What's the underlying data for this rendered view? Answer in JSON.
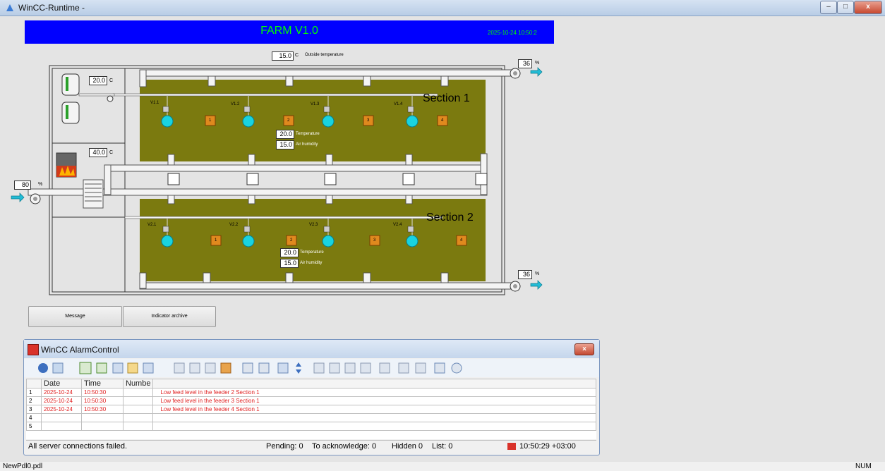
{
  "window": {
    "title": "WinCC-Runtime -",
    "controls": {
      "minimize": "–",
      "maximize": "□",
      "close": "x"
    }
  },
  "header": {
    "title": "FARM V1.0",
    "datetime": "2025-10-24 10:50:2"
  },
  "outside": {
    "value": "15.0",
    "unit": "C",
    "label": "Outside temperature"
  },
  "boiler": {
    "value": "20.0",
    "unit": "C"
  },
  "heater": {
    "value": "40.0",
    "unit": "C"
  },
  "inlet": {
    "value": "80",
    "unit": "%"
  },
  "exhaust_top": {
    "value": "36",
    "unit": "%"
  },
  "exhaust_bottom": {
    "value": "36",
    "unit": "%"
  },
  "section1": {
    "name": "Section 1",
    "valves": [
      "V1.1",
      "V1.2",
      "V1.3",
      "V1.4"
    ],
    "feeders": [
      "1",
      "2",
      "3",
      "4"
    ],
    "temperature": {
      "value": "20.0",
      "label": "Temperature"
    },
    "humidity": {
      "value": "15.0",
      "label": "Air humidity"
    }
  },
  "section2": {
    "name": "Section 2",
    "valves": [
      "V2.1",
      "V2.2",
      "V2.3",
      "V2.4"
    ],
    "feeders": [
      "1",
      "2",
      "3",
      "4"
    ],
    "temperature": {
      "value": "20.0",
      "label": "Temperature"
    },
    "humidity": {
      "value": "15.0",
      "label": "Air humidity"
    }
  },
  "buttons": {
    "message": "Message",
    "indicator_archive": "Indicator archive"
  },
  "alarm": {
    "title": "WinCC AlarmControl",
    "columns": [
      "",
      "Date",
      "Time",
      "Numbe",
      ""
    ],
    "rows": [
      {
        "n": "1",
        "date": "2025-10-24",
        "time": "10:50:30",
        "number": "",
        "text": "Low feed level in the feeder 2 Section 1"
      },
      {
        "n": "2",
        "date": "2025-10-24",
        "time": "10:50:30",
        "number": "",
        "text": "Low feed level in the feeder 3 Section 1"
      },
      {
        "n": "3",
        "date": "2025-10-24",
        "time": "10:50:30",
        "number": "",
        "text": "Low feed level in the feeder 4 Section 1"
      },
      {
        "n": "4",
        "date": "",
        "time": "",
        "number": "",
        "text": ""
      },
      {
        "n": "5",
        "date": "",
        "time": "",
        "number": "",
        "text": ""
      }
    ],
    "status": {
      "message": "All server connections failed.",
      "pending": "Pending: 0",
      "to_ack": "To acknowledge: 0",
      "hidden": "Hidden 0",
      "list": "List: 0",
      "time": "10:50:29 +03:00"
    }
  },
  "statusbar": {
    "file": "NewPdl0.pdl",
    "num": "NUM"
  },
  "colors": {
    "section_fill": "#7b7a0f",
    "header_bg": "#0000ff",
    "header_text": "#00ff00",
    "valve": "#19d3e0",
    "feeder": "#e0891e"
  }
}
